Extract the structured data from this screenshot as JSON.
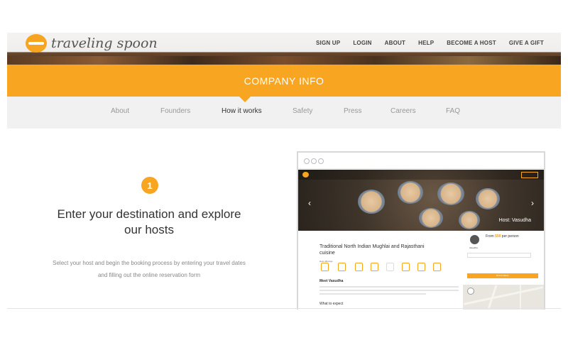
{
  "header": {
    "logo_text": "traveling spoon",
    "nav": [
      "SIGN UP",
      "LOGIN",
      "ABOUT",
      "HELP",
      "BECOME A HOST",
      "GIVE A GIFT"
    ]
  },
  "banner": {
    "title": "COMPANY INFO"
  },
  "tabs": {
    "items": [
      "About",
      "Founders",
      "How it works",
      "Safety",
      "Press",
      "Careers",
      "FAQ"
    ],
    "active": "How it works"
  },
  "step": {
    "number": "1",
    "title_line1": "Enter your destination and explore",
    "title_line2": "our hosts",
    "desc_line1": "Select your host and begin the booking process by entering your travel dates",
    "desc_line2": "and filling out the online reservation form"
  },
  "preview": {
    "hero_host": "Host: Vasudha",
    "meal_title": "Traditional North Indian Mughlai and Rajasthani cuisine",
    "host_offerings": "Host offerings",
    "meet_heading": "Meet Vasudha",
    "what_to_expect": "What to expect",
    "price_prefix": "From ",
    "price_value": "$98",
    "price_suffix": " per person",
    "avatar_name": "Vasudha",
    "book_button": "BOOK MEAL"
  },
  "colors": {
    "accent": "#f8a521",
    "tabs_bg": "#f1f1f1",
    "text_dark": "#333333"
  }
}
